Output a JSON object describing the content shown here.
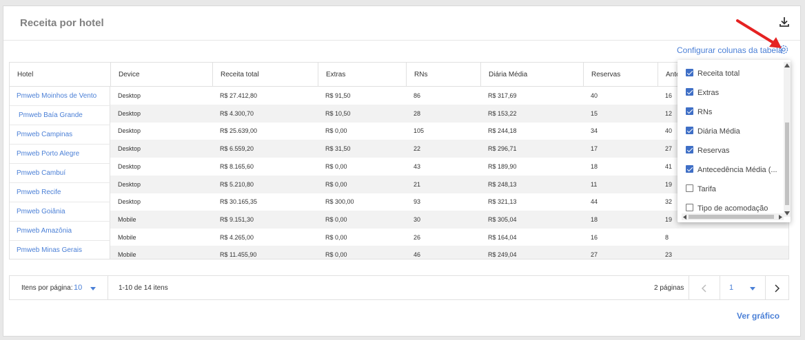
{
  "card": {
    "title": "Receita por hotel",
    "config_link": "Configurar colunas da tabela"
  },
  "icons": {
    "download": "download-icon",
    "settings": "gear-icon",
    "annotation": "red-arrow-icon"
  },
  "colors": {
    "accent": "#4a7fd6",
    "checkbox": "#3f6fc6",
    "annotation_arrow": "#e52222",
    "stripe": "#f2f2f2"
  },
  "table": {
    "headers": [
      "Hotel",
      "Device",
      "Receita total",
      "Extras",
      "RNs",
      "Diária Média",
      "Reservas",
      "Ante"
    ],
    "hotels": [
      "Pmweb Moinhos de Vento",
      "Pmweb Baía Grande",
      "Pmweb Campinas",
      "Pmweb Porto Alegre",
      "Pmweb Cambuí",
      "Pmweb Recife",
      "Pmweb Goiânia",
      "Pmweb Amazônia",
      "Pmweb Minas Gerais"
    ],
    "rows": [
      [
        "Desktop",
        "R$ 27.412,80",
        "R$ 91,50",
        "86",
        "R$ 317,69",
        "40",
        "16"
      ],
      [
        "Desktop",
        "R$ 4.300,70",
        "R$ 10,50",
        "28",
        "R$ 153,22",
        "15",
        "12"
      ],
      [
        "Desktop",
        "R$ 25.639,00",
        "R$ 0,00",
        "105",
        "R$ 244,18",
        "34",
        "40"
      ],
      [
        "Desktop",
        "R$ 6.559,20",
        "R$ 31,50",
        "22",
        "R$ 296,71",
        "17",
        "27"
      ],
      [
        "Desktop",
        "R$ 8.165,60",
        "R$ 0,00",
        "43",
        "R$ 189,90",
        "18",
        "41"
      ],
      [
        "Desktop",
        "R$ 5.210,80",
        "R$ 0,00",
        "21",
        "R$ 248,13",
        "11",
        "19"
      ],
      [
        "Desktop",
        "R$ 30.165,35",
        "R$ 300,00",
        "93",
        "R$ 321,13",
        "44",
        "32"
      ],
      [
        "Mobile",
        "R$ 9.151,30",
        "R$ 0,00",
        "30",
        "R$ 305,04",
        "18",
        "19"
      ],
      [
        "Mobile",
        "R$ 4.265,00",
        "R$ 0,00",
        "26",
        "R$ 164,04",
        "16",
        "8"
      ],
      [
        "Mobile",
        "R$ 11.455,90",
        "R$ 0,00",
        "46",
        "R$ 249,04",
        "27",
        "23"
      ]
    ]
  },
  "column_config": {
    "items": [
      {
        "label": "Receita total",
        "checked": true
      },
      {
        "label": "Extras",
        "checked": true
      },
      {
        "label": "RNs",
        "checked": true
      },
      {
        "label": "Diária Média",
        "checked": true
      },
      {
        "label": "Reservas",
        "checked": true
      },
      {
        "label": "Antecedência Média (...",
        "checked": true
      },
      {
        "label": "Tarifa",
        "checked": false
      },
      {
        "label": "Tipo de acomodação",
        "checked": false
      }
    ]
  },
  "paginator": {
    "items_per_page_label": "Itens por página:",
    "items_per_page_value": "10",
    "range_label": "1-10 de 14 itens",
    "pages_label": "2 páginas",
    "current_page": "1"
  },
  "footer": {
    "chart_link": "Ver gráfico"
  }
}
